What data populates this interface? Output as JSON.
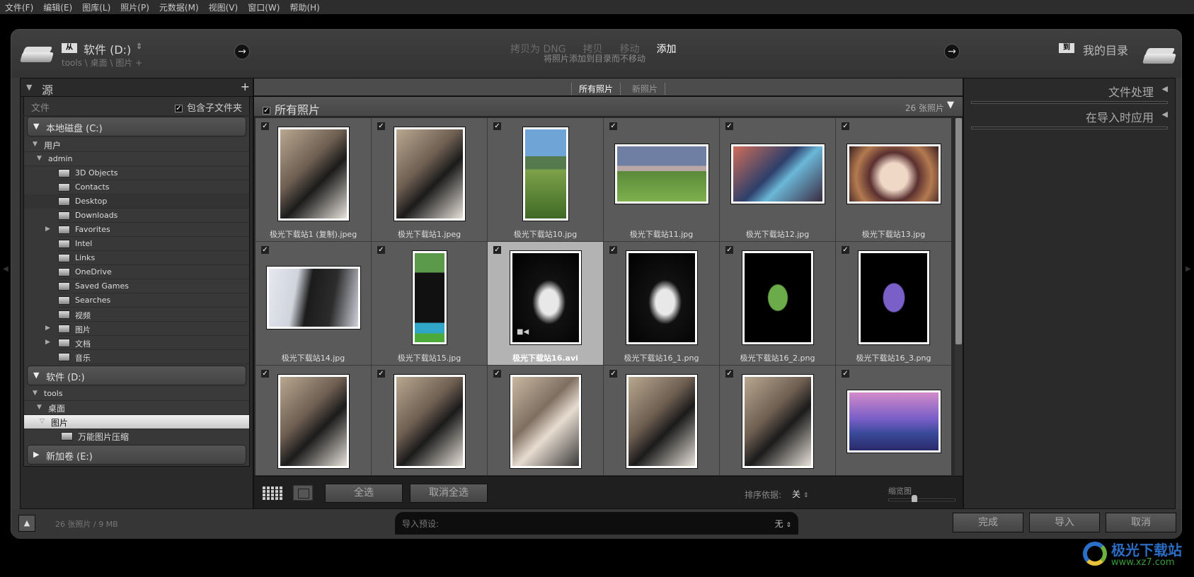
{
  "menubar": [
    "文件(F)",
    "编辑(E)",
    "图库(L)",
    "照片(P)",
    "元数据(M)",
    "视图(V)",
    "窗口(W)",
    "帮助(H)"
  ],
  "source": {
    "badge": "从",
    "name": "软件 (D:)",
    "path": "tools \\ 桌面 \\ 图片 +"
  },
  "modes": {
    "items": [
      "拷贝为 DNG",
      "拷贝",
      "移动",
      "添加"
    ],
    "active": "添加",
    "description": "将照片添加到目录而不移动"
  },
  "destination": {
    "badge": "到",
    "name": "我的目录"
  },
  "left_panel": {
    "title": "源",
    "files_label": "文件",
    "include_subfolders": "包含子文件夹",
    "volumes": [
      {
        "name": "本地磁盘 (C:)"
      },
      {
        "name": "软件 (D:)"
      },
      {
        "name": "新加卷 (E:)"
      }
    ],
    "c_tree": {
      "users": "用户",
      "admin": "admin",
      "folders": [
        "3D Objects",
        "Contacts",
        "Desktop",
        "Downloads",
        "Favorites",
        "Intel",
        "Links",
        "OneDrive",
        "Saved Games",
        "Searches",
        "视频",
        "图片",
        "文档",
        "音乐"
      ]
    },
    "d_tree": {
      "tools": "tools",
      "desktop": "桌面",
      "pictures": "图片",
      "sub": "万能图片压缩"
    }
  },
  "center": {
    "tabs": [
      "所有照片",
      "新照片"
    ],
    "grid_title": "所有照片",
    "count": "26 张照片",
    "photos": [
      {
        "name": "极光下载站1 (复制).jpeg",
        "checked": true
      },
      {
        "name": "极光下载站1.jpeg",
        "checked": true
      },
      {
        "name": "极光下载站10.jpg",
        "checked": true
      },
      {
        "name": "极光下载站11.jpg",
        "checked": true
      },
      {
        "name": "极光下载站12.jpg",
        "checked": true
      },
      {
        "name": "极光下载站13.jpg",
        "checked": true
      },
      {
        "name": "极光下载站14.jpg",
        "checked": true
      },
      {
        "name": "极光下载站15.jpg",
        "checked": true
      },
      {
        "name": "极光下载站16.avi",
        "checked": true,
        "selected": true,
        "video": true
      },
      {
        "name": "极光下载站16_1.png",
        "checked": true
      },
      {
        "name": "极光下载站16_2.png",
        "checked": true
      },
      {
        "name": "极光下载站16_3.png",
        "checked": true
      },
      {
        "name": "",
        "checked": true
      },
      {
        "name": "",
        "checked": true
      },
      {
        "name": "",
        "checked": true
      },
      {
        "name": "",
        "checked": true
      },
      {
        "name": "",
        "checked": true
      },
      {
        "name": "",
        "checked": true
      }
    ],
    "footer": {
      "select_all": "全选",
      "deselect_all": "取消全选",
      "sort_label": "排序依据:",
      "sort_value": "关",
      "thumb_label": "缩览图",
      "thumb_size": 0.35
    }
  },
  "right_panel": {
    "sections": [
      "文件处理",
      "在导入时应用"
    ]
  },
  "bottom": {
    "status": "26 张照片 / 9 MB",
    "preset_label": "导入预设:",
    "preset_value": "无",
    "done": "完成",
    "import": "导入",
    "cancel": "取消"
  },
  "watermark": {
    "name": "极光下载站",
    "url": "www.xz7.com"
  }
}
